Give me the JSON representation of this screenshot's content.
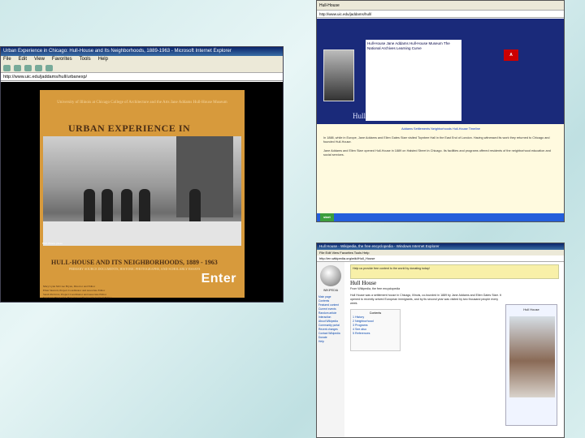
{
  "screenshot1": {
    "window_title": "Urban Experience in Chicago: Hull-House and Its Neighborhoods, 1889-1963 - Microsoft Internet Explorer",
    "menu": [
      "File",
      "Edit",
      "View",
      "Favorites",
      "Tools",
      "Help"
    ],
    "address": "http://www.uic.edu/jaddams/hull/urbanexp/",
    "site_top": "University of Illinois at Chicago   College of Architecture and the Arts   Jane Addams Hull-House Museum",
    "main_title": "URBAN EXPERIENCE IN CHICAGO:",
    "photo_caption": "Hull-House photo",
    "subtitle": "HULL-HOUSE AND ITS NEIGHBORHOODS, 1889 - 1963",
    "tagline": "PRIMARY SOURCE DOCUMENTS, HISTORIC PHOTOGRAPHS, AND SCHOLARLY ESSAYS",
    "enter_label": "Enter",
    "credits": [
      "Mary Lynn McCree Bryan, Director and Editor",
      "Ellen Skerrett, Project Coordinator and Associate Editor",
      "Sarah Pavlovic, Project Coordinator and Associate Editor",
      "Stephanie Fitzgerald, Project Coordinator and Assistant Editor"
    ]
  },
  "screenshot2": {
    "browser_label": "Hull-House",
    "address": "http://www.uic.edu/jaddams/hull/",
    "panel_text": "Hull-House   Jane Addams Hull-House Museum   The National Archives   Learning Curve",
    "badge": "A",
    "header_label": "Hull House",
    "links": "Addams   Settlements   Neighborhoods   Hull-House Timeline",
    "para1": "In 1888, while in Europe, Jane Addams and Ellen Gates Starr visited Toynbee Hall in the East End of London. Having witnessed its work they returned to Chicago and founded Hull-House.",
    "para2": "Jane Addams and Ellen Starr opened Hull-House in 1889 on Halsted Street in Chicago. Its facilities and programs offered residents of the neighborhood education and social services.",
    "taskbar_start": "start"
  },
  "screenshot3": {
    "window_title": "Hull House - Wikipedia, the free encyclopedia - Windows Internet Explorer",
    "menu": "File  Edit  View  Favorites  Tools  Help",
    "address": "http://en.wikipedia.org/wiki/Hull_House",
    "logo_label": "WIKIPEDIA",
    "side_links": [
      "Main page",
      "Contents",
      "Featured content",
      "Current events",
      "Random article",
      "Interaction",
      "About Wikipedia",
      "Community portal",
      "Recent changes",
      "Contact Wikipedia",
      "Donate",
      "Help"
    ],
    "banner_text": "Help us provide free content to the world by donating today!",
    "article_title": "Hull House",
    "article_sub": "From Wikipedia, the free encyclopedia",
    "body": "Hull House was a settlement house in Chicago, Illinois, co-founded in 1889 by Jane Addams and Ellen Gates Starr. It opened to recently arrived European immigrants, and by its second year was visited by two thousand people every week.",
    "toc_title": "Contents",
    "toc_items": [
      "1 History",
      "2 Neighborhood",
      "3 Programs",
      "4 See also",
      "5 References"
    ],
    "infobox_title": "Hull House"
  }
}
